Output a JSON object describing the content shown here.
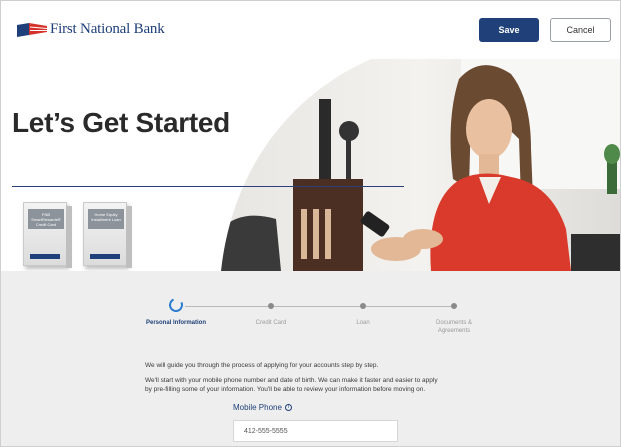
{
  "header": {
    "logo_text": "First National Bank",
    "save_label": "Save",
    "cancel_label": "Cancel"
  },
  "hero": {
    "title": "Let’s Get Started",
    "products": [
      {
        "label": "FNB SmartRewards® Credit Card"
      },
      {
        "label": "Home Equity Installment Loan"
      }
    ]
  },
  "stepper": {
    "steps": [
      {
        "label": "Personal Information",
        "state": "active"
      },
      {
        "label": "Credit Card",
        "state": "pending"
      },
      {
        "label": "Loan",
        "state": "pending"
      },
      {
        "label": "Documents & Agreements",
        "state": "pending"
      }
    ]
  },
  "intro": {
    "line1": "We will guide you through the process of applying for your accounts step by step.",
    "line2": "We'll start with your mobile phone number and date of birth. We can make it faster and easier to apply",
    "line3": "by pre-filling some of your information. You'll be able to review your information before moving on."
  },
  "form": {
    "phone_label": "Mobile Phone",
    "info_icon": "info-icon",
    "phone_value": "412-555-5555"
  },
  "colors": {
    "brand_navy": "#1f4079",
    "accent_blue": "#2b7bd0",
    "sweater_red": "#d93a2b"
  }
}
